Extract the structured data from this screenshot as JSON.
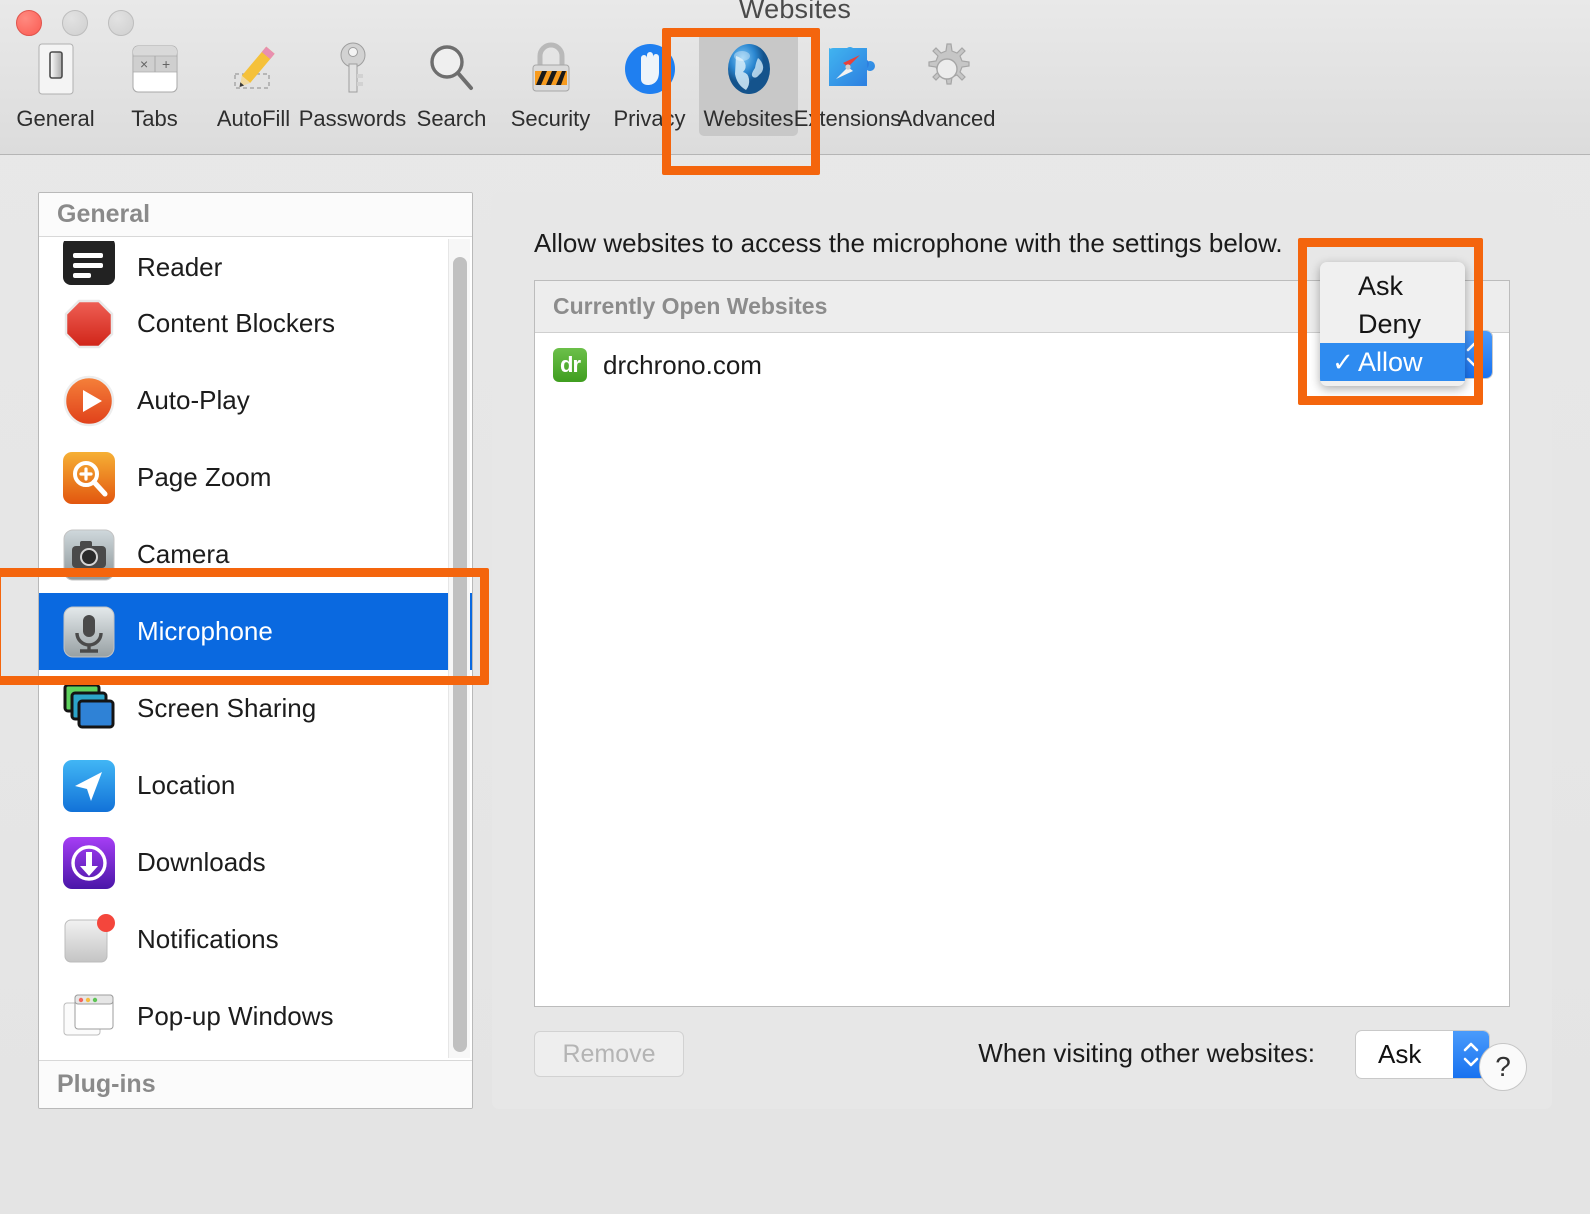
{
  "window": {
    "title": "Websites",
    "traffic_lights": [
      "close-button",
      "minimize-button",
      "maximize-button"
    ]
  },
  "toolbar": {
    "items": [
      {
        "label": "General",
        "icon": "general-icon",
        "selected": false
      },
      {
        "label": "Tabs",
        "icon": "tabs-icon",
        "selected": false
      },
      {
        "label": "AutoFill",
        "icon": "autofill-icon",
        "selected": false
      },
      {
        "label": "Passwords",
        "icon": "passwords-icon",
        "selected": false
      },
      {
        "label": "Search",
        "icon": "search-icon",
        "selected": false
      },
      {
        "label": "Security",
        "icon": "security-icon",
        "selected": false
      },
      {
        "label": "Privacy",
        "icon": "privacy-icon",
        "selected": false
      },
      {
        "label": "Websites",
        "icon": "websites-icon",
        "selected": true
      },
      {
        "label": "Extensions",
        "icon": "extensions-icon",
        "selected": false
      },
      {
        "label": "Advanced",
        "icon": "advanced-icon",
        "selected": false
      }
    ]
  },
  "sidebar": {
    "section_header": "General",
    "section_footer": "Plug-ins",
    "items": [
      {
        "label": "Reader",
        "icon": "reader-icon",
        "selected": false,
        "partial": true
      },
      {
        "label": "Content Blockers",
        "icon": "content-blockers-icon",
        "selected": false,
        "partial": false
      },
      {
        "label": "Auto-Play",
        "icon": "auto-play-icon",
        "selected": false,
        "partial": false
      },
      {
        "label": "Page Zoom",
        "icon": "page-zoom-icon",
        "selected": false,
        "partial": false
      },
      {
        "label": "Camera",
        "icon": "camera-icon",
        "selected": false,
        "partial": false
      },
      {
        "label": "Microphone",
        "icon": "microphone-icon",
        "selected": true,
        "partial": false
      },
      {
        "label": "Screen Sharing",
        "icon": "screen-sharing-icon",
        "selected": false,
        "partial": false
      },
      {
        "label": "Location",
        "icon": "location-icon",
        "selected": false,
        "partial": false
      },
      {
        "label": "Downloads",
        "icon": "downloads-icon",
        "selected": false,
        "partial": false
      },
      {
        "label": "Notifications",
        "icon": "notifications-icon",
        "selected": false,
        "partial": false
      },
      {
        "label": "Pop-up Windows",
        "icon": "popup-windows-icon",
        "selected": false,
        "partial": false
      }
    ]
  },
  "main": {
    "description": "Allow websites to access the microphone with the settings below.",
    "list_header": "Currently Open Websites",
    "rows": [
      {
        "site": "drchrono.com",
        "favicon_text": "dr",
        "favicon_color": "#4aa82a"
      }
    ],
    "remove_button": "Remove",
    "other_websites_label": "When visiting other websites:",
    "other_websites_value": "Ask",
    "help_button": "?"
  },
  "dropdown": {
    "open": true,
    "options": [
      {
        "label": "Ask",
        "checked": false
      },
      {
        "label": "Deny",
        "checked": false
      },
      {
        "label": "Allow",
        "checked": true
      }
    ],
    "check_glyph": "✓"
  },
  "annotations": {
    "color": "#f4650d",
    "boxes": [
      "websites-toolbar-item",
      "permission-dropdown-menu",
      "microphone-sidebar-item"
    ]
  },
  "colors": {
    "selection_blue": "#0a69e0",
    "menu_highlight_blue": "#2e8bf0",
    "annotation_orange": "#f4650d",
    "panel_background": "#e7e7e7"
  }
}
